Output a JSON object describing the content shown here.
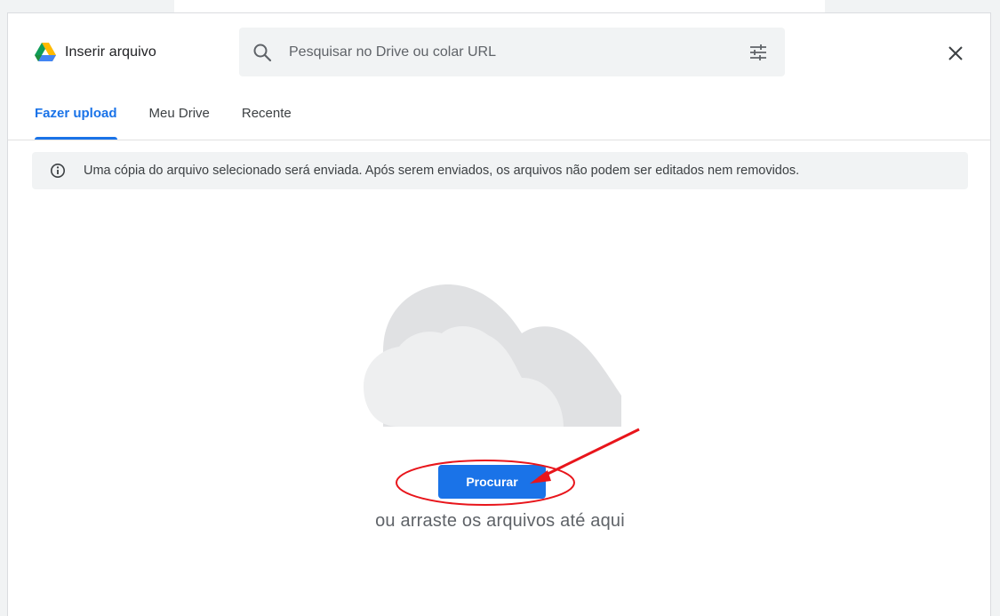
{
  "dialog": {
    "title": "Inserir arquivo",
    "close_label": "close"
  },
  "search": {
    "placeholder": "Pesquisar no Drive ou colar URL",
    "value": ""
  },
  "tabs": [
    {
      "label": "Fazer upload",
      "active": true
    },
    {
      "label": "Meu Drive",
      "active": false
    },
    {
      "label": "Recente",
      "active": false
    }
  ],
  "info_banner": {
    "text": "Uma cópia do arquivo selecionado será enviada. Após serem enviados, os arquivos não podem ser editados nem removidos."
  },
  "upload": {
    "browse_label": "Procurar",
    "drag_text": "ou arraste os arquivos até aqui"
  },
  "icons": {
    "logo": "google-drive-icon",
    "search": "search-icon",
    "tune": "tune-icon",
    "close": "close-icon",
    "info": "info-icon",
    "cloud": "cloud-illustration"
  },
  "colors": {
    "accent": "#1a73e8",
    "annotation": "#e8151b",
    "banner_bg": "#f1f3f4",
    "cloud": "#e0e1e3"
  }
}
